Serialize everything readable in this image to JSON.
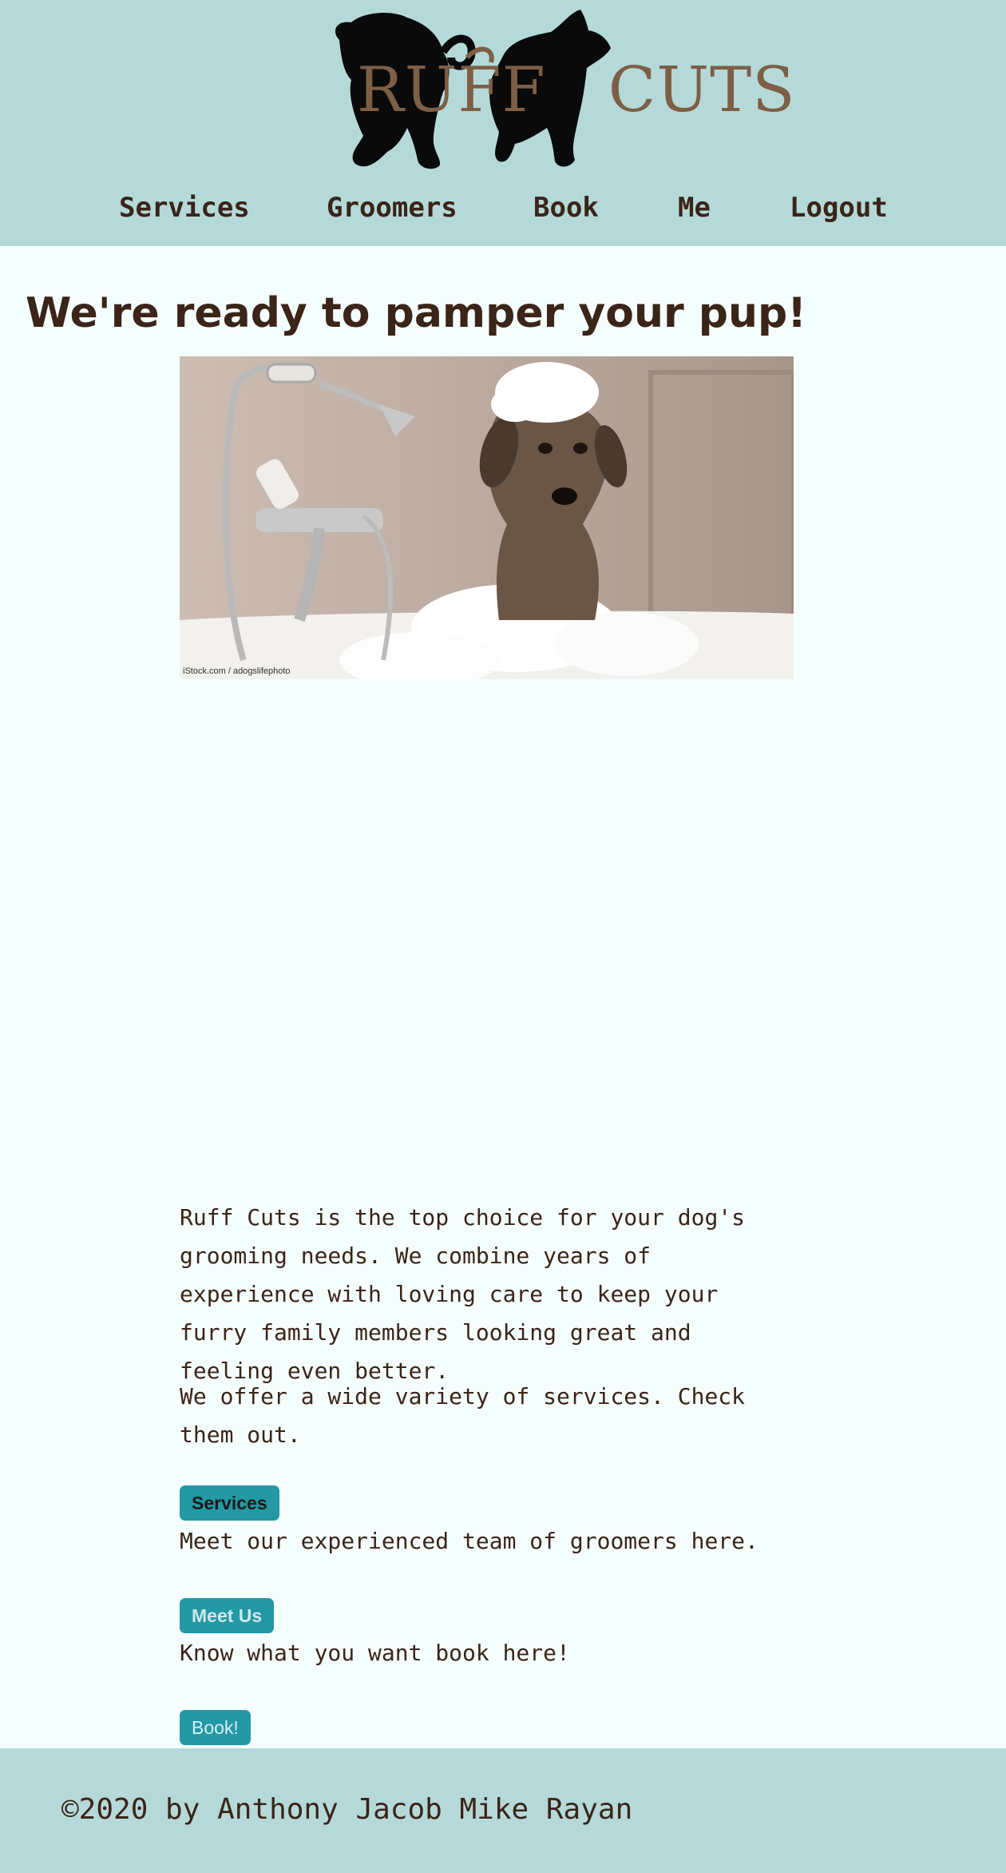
{
  "brand": {
    "logo_text_left": "RUFF",
    "logo_text_right": "CUTS"
  },
  "nav": {
    "items": [
      "Services",
      "Groomers",
      "Book",
      "Me",
      "Logout"
    ]
  },
  "main": {
    "headline": "We're ready to pamper your pup!",
    "hero_image": {
      "credit": "iStock.com / adogslifephoto"
    },
    "intro_paragraph": "Ruff Cuts is the top choice for your dog's grooming needs. We combine years of experience with loving care to keep your furry family members looking great and feeling even better.",
    "services_paragraph": "We offer a wide variety of services. Check them out.",
    "services_button": "Services",
    "groomers_paragraph": "Meet our experienced team of groomers here.",
    "meet_button": "Meet Us",
    "book_paragraph": "Know what you want book here!",
    "book_button": "Book!"
  },
  "footer": {
    "copyright": "©2020 by Anthony Jacob Mike Rayan"
  },
  "colors": {
    "header_bg": "#b4d9d8",
    "page_bg": "#f4fffd",
    "text": "#3b2418",
    "button_bg": "#2299a5",
    "logo_text": "#7d5f45"
  }
}
